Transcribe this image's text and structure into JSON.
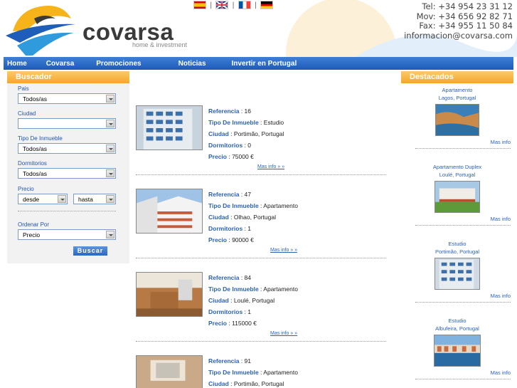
{
  "header": {
    "brand": "covarsa",
    "tagline": "home & investment",
    "languages": [
      "Español",
      "English",
      "Français",
      "Deutsch"
    ],
    "contact": {
      "tel": "Tel: +34 954 23 31 12",
      "mov": "Mov: +34 656 92 82 71",
      "fax": "Fax: +34 955 11 50 84",
      "email": "informacion@covarsa.com"
    }
  },
  "nav": [
    "Home",
    "Covarsa",
    "Promociones",
    "Noticias",
    "Invertir en Portugal"
  ],
  "search": {
    "title": "Buscador",
    "pais_label": "Pais",
    "pais_value": "Todos/as",
    "ciudad_label": "Ciudad",
    "ciudad_value": "",
    "tipo_label": "Tipo De Inmueble",
    "tipo_value": "Todos/as",
    "dorm_label": "Dormitorios",
    "dorm_value": "Todos/as",
    "precio_label": "Precio",
    "desde": "desde",
    "hasta": "hasta",
    "orden_label": "Ordenar Por",
    "orden_value": "Precio",
    "button": "Buscar"
  },
  "listing_labels": {
    "ref": "Referencia",
    "tipo": "Tipo De Inmueble",
    "ciudad": "Ciudad",
    "dorm": "Dormitorios",
    "precio": "Precio",
    "mas": "Mas info » »"
  },
  "listings": [
    {
      "ref": " : 16",
      "tipo": " : Estudio",
      "ciudad": " : Portimão, Portugal",
      "dorm": " : 0",
      "precio": " : 75000  €"
    },
    {
      "ref": " : 47",
      "tipo": " : Apartamento",
      "ciudad": " : Olhao, Portugal",
      "dorm": " : 1",
      "precio": " : 90000  €"
    },
    {
      "ref": " : 84",
      "tipo": " : Apartamento",
      "ciudad": " : Loulé, Portugal",
      "dorm": " : 1",
      "precio": " : 115000  €"
    },
    {
      "ref": " : 91",
      "tipo": " : Apartamento",
      "ciudad": " : Portimão, Portugal",
      "dorm": "",
      "precio": ""
    }
  ],
  "featured": {
    "title": "Destacados",
    "mas": "Mas info",
    "items": [
      {
        "type": "Apartamento",
        "place": "Lagos, Portugal"
      },
      {
        "type": "Apartamento Duplex",
        "place": "Loulé, Portugal"
      },
      {
        "type": "Estudio",
        "place": "Portimão, Portugal"
      },
      {
        "type": "Estudio",
        "place": "Albufeira, Portugal"
      }
    ]
  },
  "colors": {
    "nav": "#2563be",
    "panel": "#f5a832",
    "link": "#2c62b6"
  }
}
